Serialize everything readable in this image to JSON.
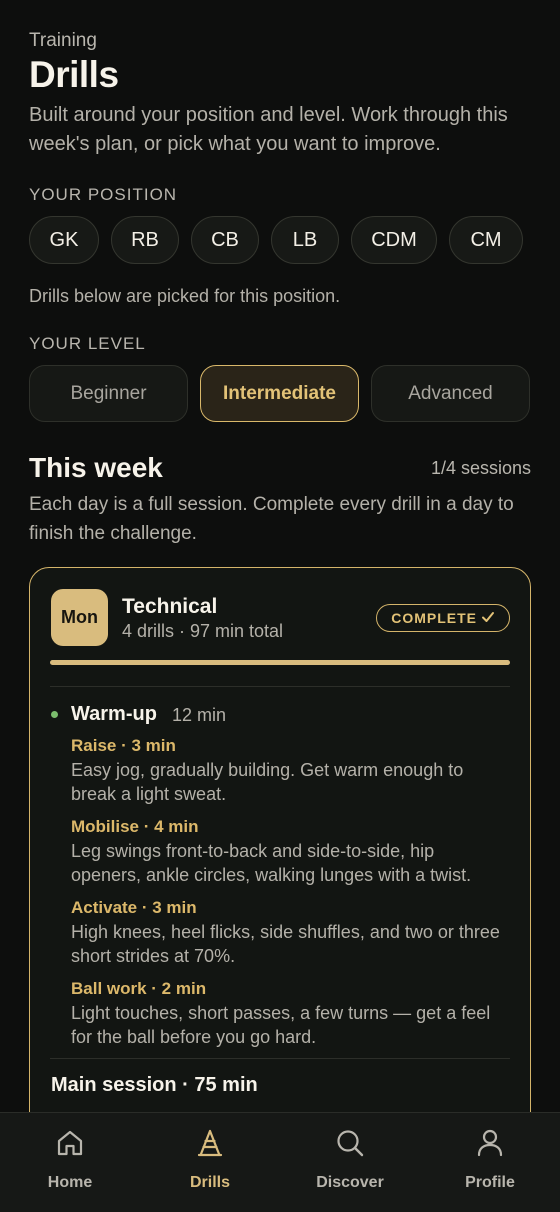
{
  "header": {
    "eyebrow": "Training",
    "title": "Drills",
    "intro": "Built around your position and level. Work through this week's plan, or pick what you want to improve."
  },
  "position": {
    "label": "YOUR POSITION",
    "options": [
      "GK",
      "RB",
      "CB",
      "LB",
      "CDM",
      "CM"
    ],
    "note": "Drills below are picked for this position."
  },
  "level": {
    "label": "YOUR LEVEL",
    "options": [
      "Beginner",
      "Intermediate",
      "Advanced"
    ],
    "selected": "Intermediate"
  },
  "week": {
    "title": "This week",
    "count": "1/4 sessions",
    "note": "Each day is a full session. Complete every drill in a day to finish the challenge."
  },
  "session": {
    "day": "Mon",
    "title": "Technical",
    "subtitle": "4 drills · 97 min total",
    "status": "COMPLETE",
    "status_icon": "check-icon",
    "progress": 1.0,
    "warmup": {
      "title": "Warm-up",
      "duration": "12 min",
      "drills": [
        {
          "head": "Raise · 3 min",
          "desc": "Easy jog, gradually building. Get warm enough to break a light sweat."
        },
        {
          "head": "Mobilise · 4 min",
          "desc": "Leg swings front-to-back and side-to-side, hip openers, ankle circles, walking lunges with a twist."
        },
        {
          "head": "Activate · 3 min",
          "desc": "High knees, heel flicks, side shuffles, and two or three short strides at 70%."
        },
        {
          "head": "Ball work · 2 min",
          "desc": "Light touches, short passes, a few turns — get a feel for the ball before you go hard."
        }
      ]
    },
    "main_label": "Main session · 75 min"
  },
  "tabs": [
    {
      "label": "Home",
      "icon": "home-icon"
    },
    {
      "label": "Drills",
      "icon": "cone-icon",
      "active": true
    },
    {
      "label": "Discover",
      "icon": "search-icon"
    },
    {
      "label": "Profile",
      "icon": "person-icon"
    }
  ],
  "colors": {
    "accent": "#d9bc7e",
    "background": "#0d0e0d",
    "status_dot": "#7bbd6d"
  }
}
